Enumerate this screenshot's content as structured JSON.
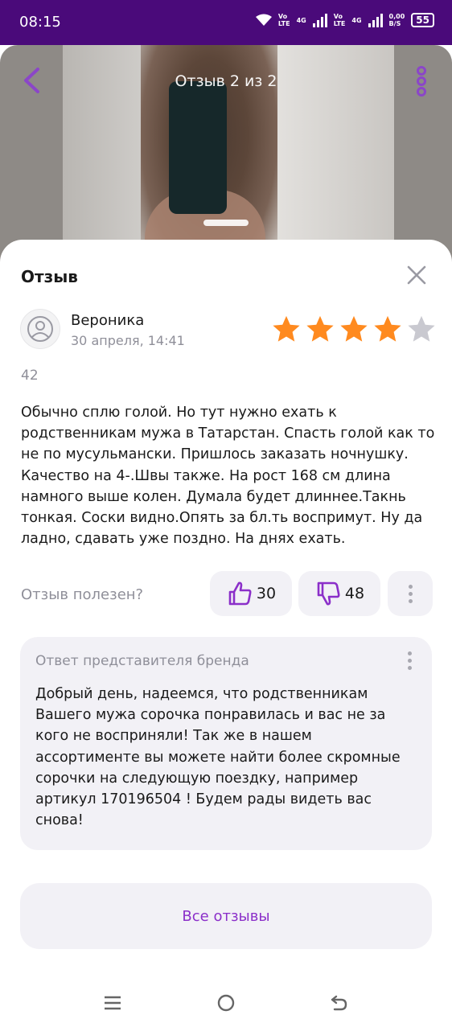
{
  "status_bar": {
    "time": "08:15",
    "net1_top": "Vo",
    "net1_bottom": "LTE",
    "net1_gen": "4G",
    "net2_top": "Vo",
    "net2_bottom": "LTE",
    "net2_gen": "4G",
    "speed_top": "0,00",
    "speed_bottom": "B/S",
    "battery": "55"
  },
  "header": {
    "title": "Отзыв 2 из 2",
    "back_icon": "chevron-left-icon",
    "more_icon": "vertical-dots-icon"
  },
  "sheet": {
    "title": "Отзыв",
    "close_icon": "close-icon"
  },
  "review": {
    "author": "Вероника",
    "date": "30 апреля, 14:41",
    "rating": 4,
    "rating_max": 5,
    "star_color": "#ff8a1f",
    "star_empty_color": "#c9c9d0",
    "count": "42",
    "text": "Обычно сплю голой. Но тут нужно ехать к родственникам мужа в Татарстан. Спасть голой как то не по мусульмански. Пришлось заказать ночнушку. Качество на 4-.Швы также. На рост 168 см длина намного выше колен. Думала будет длиннее.Такнь тонкая. Соски видно.Опять за бл.ть воспримут. Ну да ладно, сдавать уже поздно. На днях ехать."
  },
  "helpful": {
    "label": "Отзыв полезен?",
    "likes": "30",
    "dislikes": "48",
    "accent": "#8b2fc9"
  },
  "brand_reply": {
    "title": "Ответ представителя бренда",
    "text": "Добрый день, надеемся, что родственникам Вашего мужа сорочка понравилась и вас не за кого не восприняли! Так же в нашем ассортименте вы можете найти более скромные сорочки на следующую поездку, например артикул 170196504 ! Будем рады видеть вас снова!"
  },
  "all_reviews_button": "Все отзывы",
  "nav": {
    "menu_icon": "menu-icon",
    "home_icon": "home-circle-icon",
    "back_icon": "back-arrow-icon"
  }
}
